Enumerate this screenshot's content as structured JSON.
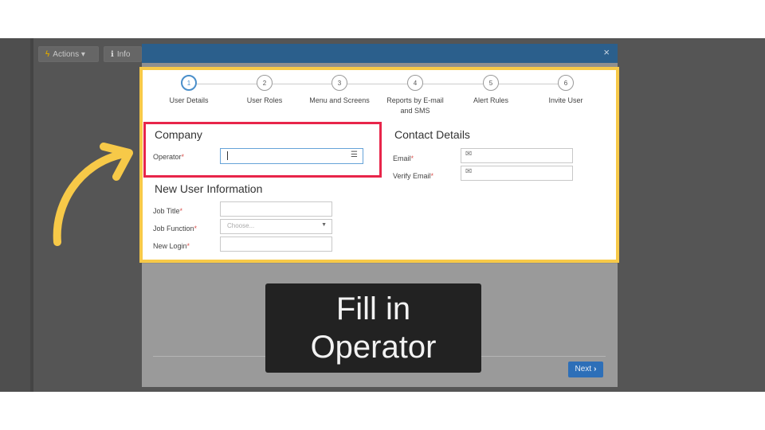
{
  "background_toolbar": {
    "actions_label": "Actions",
    "info_label": "Info"
  },
  "modal": {
    "close_glyph": "×",
    "next_label": "Next"
  },
  "steps": [
    {
      "number": "1",
      "label": "User Details",
      "active": true
    },
    {
      "number": "2",
      "label": "User Roles",
      "active": false
    },
    {
      "number": "3",
      "label": "Menu and Screens",
      "active": false
    },
    {
      "number": "4",
      "label": "Reports by E-mail\nand SMS",
      "active": false
    },
    {
      "number": "5",
      "label": "Alert Rules",
      "active": false
    },
    {
      "number": "6",
      "label": "Invite User",
      "active": false
    }
  ],
  "company": {
    "title": "Company",
    "operator_label": "Operator",
    "operator_value": ""
  },
  "new_user": {
    "title": "New User Information",
    "job_title_label": "Job Title",
    "job_function_label": "Job Function",
    "job_function_placeholder": "Choose...",
    "new_login_label": "New Login"
  },
  "contact": {
    "title": "Contact Details",
    "email_label": "Email",
    "verify_email_label": "Verify Email"
  },
  "required_mark": "*",
  "caption": {
    "text": "Fill in\nOperator"
  },
  "colors": {
    "highlight_yellow": "#f7c948",
    "highlight_red": "#e8254a",
    "modal_header": "#2b5f8c",
    "next_button": "#2d6fb8",
    "step_active": "#4a8fca",
    "required": "#d9534f"
  },
  "icons": {
    "actions": "bolt-icon",
    "info": "info-icon",
    "operator": "list-icon",
    "email": "envelope-icon",
    "select": "caret-down-icon",
    "next": "chevron-right-icon",
    "close": "close-icon",
    "annotation": "curved-arrow-icon"
  }
}
